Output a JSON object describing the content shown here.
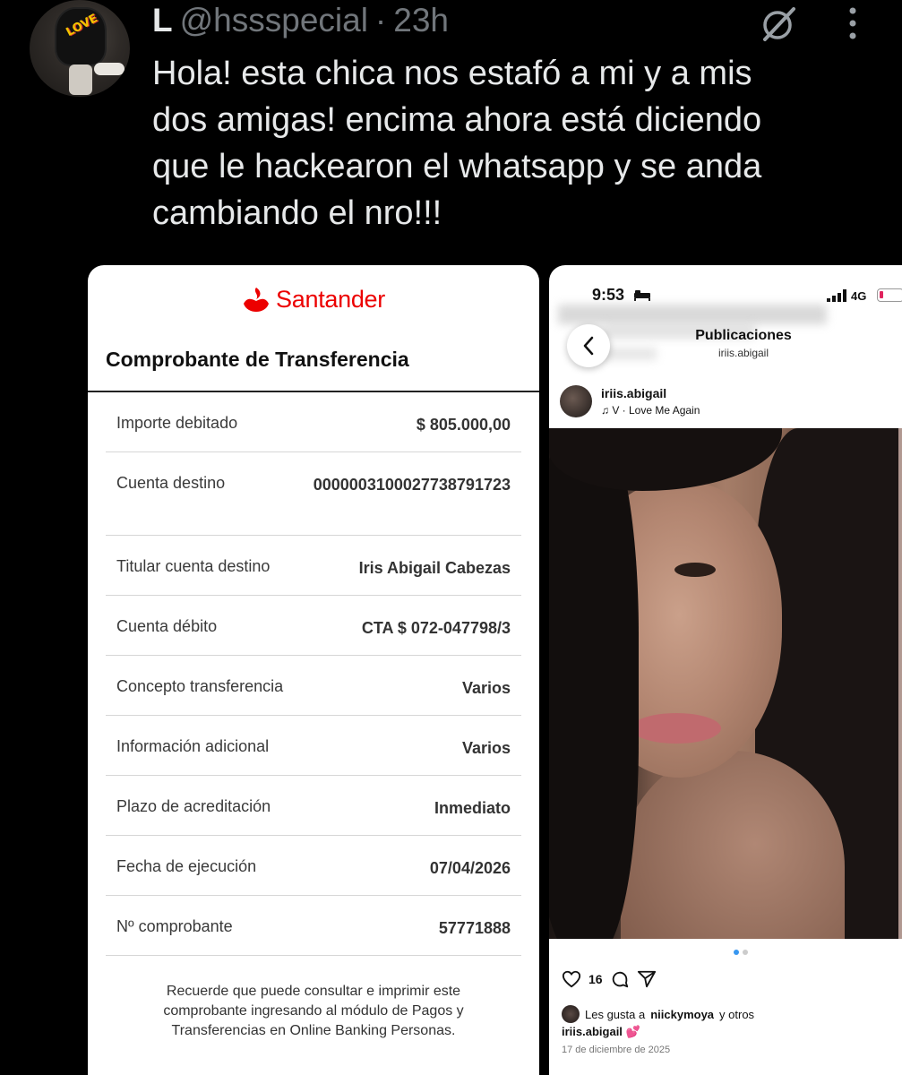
{
  "tweet": {
    "display_name": "L",
    "handle": "@hssspecial",
    "separator": "·",
    "time_ago": "23h",
    "text": "Hola! esta chica nos estafó a mi y a mis\ndos amigas! encima ahora está diciendo\nque le hackearon el whatsapp y se anda\ncambiando el nro!!!",
    "avatar_text": "LOVE"
  },
  "receipt": {
    "bank_name": "Santander",
    "brand_color": "#ec0000",
    "title": "Comprobante de Transferencia",
    "rows": [
      {
        "label": "Importe debitado",
        "value": "$ 805.000,00"
      },
      {
        "label": "Cuenta destino",
        "value": "0000003100027738791723"
      },
      {
        "label": "Titular cuenta destino",
        "value": "Iris Abigail Cabezas"
      },
      {
        "label": "Cuenta débito",
        "value": "CTA $ 072-047798/3"
      },
      {
        "label": "Concepto transferencia",
        "value": "Varios"
      },
      {
        "label": "Información adicional",
        "value": "Varios"
      },
      {
        "label": "Plazo de acreditación",
        "value": "Inmediato"
      },
      {
        "label": "Fecha de ejecución",
        "value": "07/04/2026"
      },
      {
        "label": "Nº comprobante",
        "value": "57771888"
      }
    ],
    "footer": "Recuerde que puede consultar e imprimir este comprobante ingresando al módulo de Pagos y Transferencias en Online Banking Personas."
  },
  "instagram": {
    "status_time": "9:53",
    "network": "4G",
    "header_title": "Publicaciones",
    "header_subtitle": "iriis.abigail",
    "post_user": "iriis.abigail",
    "music": "V · Love Me Again",
    "like_count": "16",
    "likes_prefix": "Les gusta a",
    "likes_user": "niickymoya",
    "likes_suffix": "y otros",
    "caption_user": "iriis.abigail",
    "caption_emoji": "💕",
    "date": "17 de diciembre de 2025",
    "accent_color": "#3897f0"
  }
}
